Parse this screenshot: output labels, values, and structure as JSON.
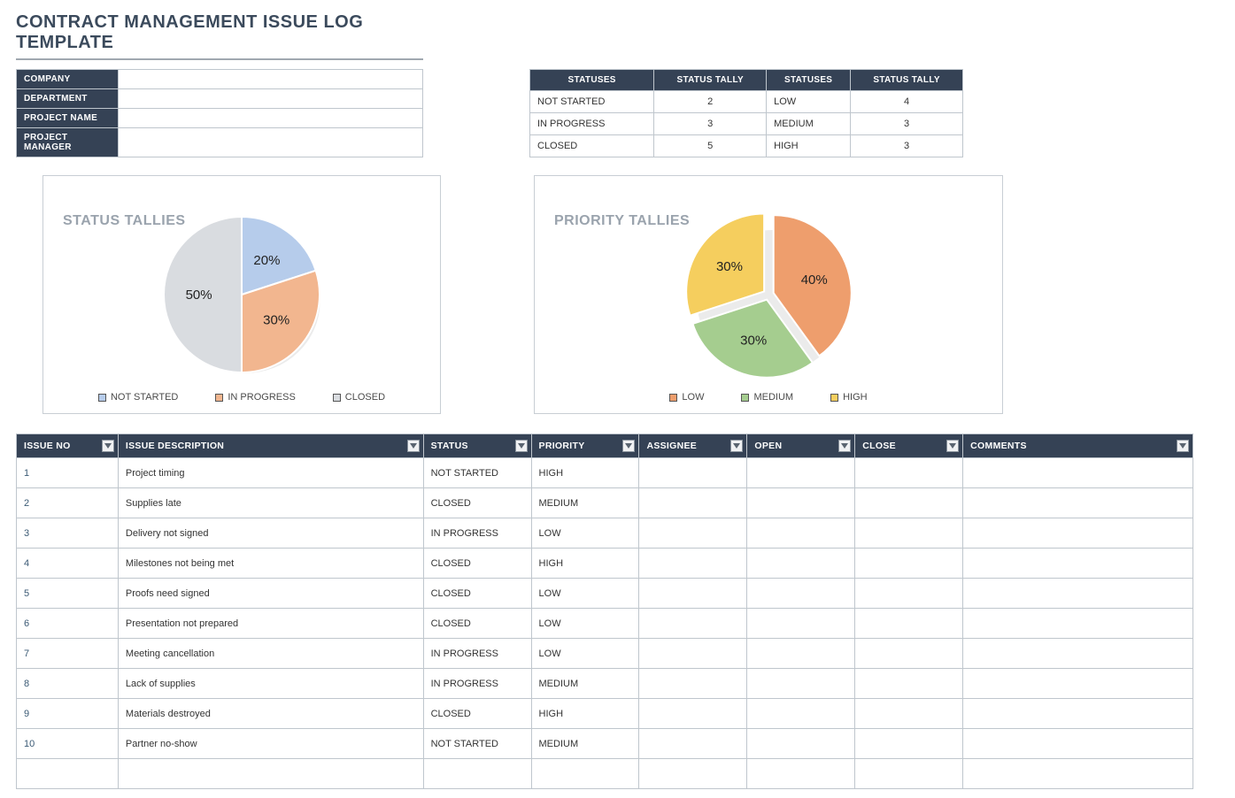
{
  "title": "CONTRACT MANAGEMENT ISSUE LOG TEMPLATE",
  "info_labels": {
    "company": "COMPANY",
    "department": "DEPARTMENT",
    "project_name": "PROJECT NAME",
    "project_manager": "PROJECT MANAGER"
  },
  "info_values": {
    "company": "",
    "department": "",
    "project_name": "",
    "project_manager": ""
  },
  "tally_headers": {
    "statuses": "STATUSES",
    "status_tally": "STATUS TALLY"
  },
  "status_tallies": [
    {
      "name": "NOT STARTED",
      "count": 2
    },
    {
      "name": "IN PROGRESS",
      "count": 3
    },
    {
      "name": "CLOSED",
      "count": 5
    }
  ],
  "priority_tallies": [
    {
      "name": "LOW",
      "count": 4
    },
    {
      "name": "MEDIUM",
      "count": 3
    },
    {
      "name": "HIGH",
      "count": 3
    }
  ],
  "chart_data": [
    {
      "type": "pie",
      "title": "STATUS TALLIES",
      "series": [
        {
          "name": "NOT STARTED",
          "value": 20,
          "color": "#b6cceb"
        },
        {
          "name": "IN PROGRESS",
          "value": 30,
          "color": "#f2b68f"
        },
        {
          "name": "CLOSED",
          "value": 50,
          "color": "#d9dce0"
        }
      ]
    },
    {
      "type": "pie",
      "title": "PRIORITY TALLIES",
      "series": [
        {
          "name": "LOW",
          "value": 40,
          "color": "#ee9e6d"
        },
        {
          "name": "MEDIUM",
          "value": 30,
          "color": "#a5cd8f"
        },
        {
          "name": "HIGH",
          "value": 30,
          "color": "#f5ce5e"
        }
      ]
    }
  ],
  "issues_headers": {
    "issue_no": "ISSUE NO",
    "description": "ISSUE DESCRIPTION",
    "status": "STATUS",
    "priority": "PRIORITY",
    "assignee": "ASSIGNEE",
    "open": "OPEN",
    "close": "CLOSE",
    "comments": "COMMENTS"
  },
  "issues": [
    {
      "no": "1",
      "desc": "Project timing",
      "status": "NOT STARTED",
      "priority": "HIGH",
      "assignee": "",
      "open": "",
      "close": "",
      "comments": ""
    },
    {
      "no": "2",
      "desc": "Supplies late",
      "status": "CLOSED",
      "priority": "MEDIUM",
      "assignee": "",
      "open": "",
      "close": "",
      "comments": ""
    },
    {
      "no": "3",
      "desc": "Delivery not signed",
      "status": "IN PROGRESS",
      "priority": "LOW",
      "assignee": "",
      "open": "",
      "close": "",
      "comments": ""
    },
    {
      "no": "4",
      "desc": "Milestones not being met",
      "status": "CLOSED",
      "priority": "HIGH",
      "assignee": "",
      "open": "",
      "close": "",
      "comments": ""
    },
    {
      "no": "5",
      "desc": "Proofs need signed",
      "status": "CLOSED",
      "priority": "LOW",
      "assignee": "",
      "open": "",
      "close": "",
      "comments": ""
    },
    {
      "no": "6",
      "desc": "Presentation not prepared",
      "status": "CLOSED",
      "priority": "LOW",
      "assignee": "",
      "open": "",
      "close": "",
      "comments": ""
    },
    {
      "no": "7",
      "desc": "Meeting cancellation",
      "status": "IN PROGRESS",
      "priority": "LOW",
      "assignee": "",
      "open": "",
      "close": "",
      "comments": ""
    },
    {
      "no": "8",
      "desc": "Lack of supplies",
      "status": "IN PROGRESS",
      "priority": "MEDIUM",
      "assignee": "",
      "open": "",
      "close": "",
      "comments": ""
    },
    {
      "no": "9",
      "desc": "Materials destroyed",
      "status": "CLOSED",
      "priority": "HIGH",
      "assignee": "",
      "open": "",
      "close": "",
      "comments": ""
    },
    {
      "no": "10",
      "desc": "Partner no-show",
      "status": "NOT STARTED",
      "priority": "MEDIUM",
      "assignee": "",
      "open": "",
      "close": "",
      "comments": ""
    },
    {
      "no": "",
      "desc": "",
      "status": "",
      "priority": "",
      "assignee": "",
      "open": "",
      "close": "",
      "comments": ""
    }
  ]
}
